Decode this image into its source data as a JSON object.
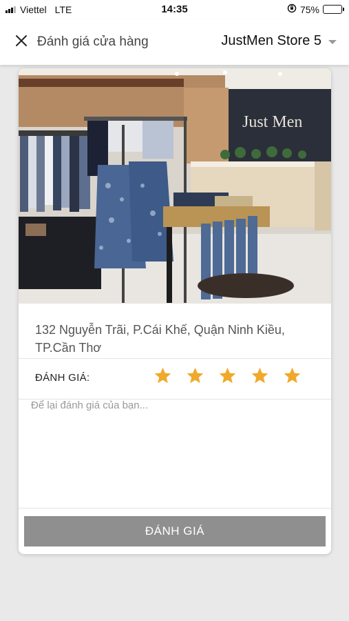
{
  "status_bar": {
    "carrier": "Viettel",
    "network": "LTE",
    "time": "14:35",
    "battery_percent": "75%",
    "battery_level": 0.75,
    "signal_icon": "signal-bars-icon",
    "orientation_icon": "orientation-lock-icon",
    "battery_icon": "battery-icon"
  },
  "header": {
    "close_icon": "close-icon",
    "title": "Đánh giá cửa hàng",
    "store_name": "JustMen Store 5",
    "dropdown_icon": "chevron-down-icon"
  },
  "store": {
    "photo_sign": "Just Men",
    "address": "132 Nguyễn Trãi, P.Cái Khế, Quận Ninh Kiều, TP.Cần Thơ"
  },
  "rating": {
    "label": "ĐÁNH GIÁ:",
    "stars": 5,
    "max_stars": 5,
    "star_color": "#f0a92b"
  },
  "review": {
    "placeholder": "Để lại đánh giá của bạn...",
    "value": ""
  },
  "submit": {
    "label": "ĐÁNH GIÁ",
    "background": "#8f8f8f"
  }
}
